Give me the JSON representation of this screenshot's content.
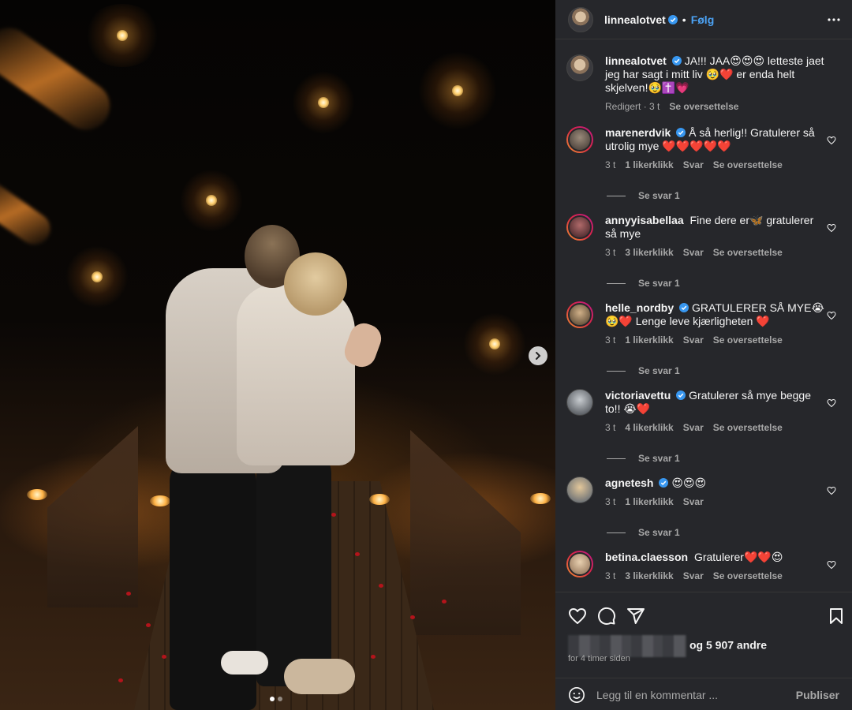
{
  "post": {
    "author": "linnealotvet",
    "follow_label": "Følg",
    "separator": "•"
  },
  "caption": {
    "username": "linnealotvet",
    "text": "JA!!! JAA😍😍😍 letteste jaet jeg har sagt i mitt liv 🥹❤️ er enda helt skjelven!🥹✝️💗",
    "edited": "Redigert · 3 t",
    "translate": "Se oversettelse"
  },
  "comments": [
    {
      "username": "marenerdvik",
      "text": "Å så herlig!! Gratulerer så utrolig mye ❤️❤️❤️❤️❤️",
      "time": "3 t",
      "likes": "1 likerklikk",
      "reply": "Svar",
      "translate": "Se oversettelse",
      "replies": "Se svar 1"
    },
    {
      "username": "annyyisabellaa",
      "text": "Fine dere er🦋 gratulerer så mye",
      "time": "3 t",
      "likes": "3 likerklikk",
      "reply": "Svar",
      "translate": "Se oversettelse",
      "replies": "Se svar 1"
    },
    {
      "username": "helle_nordby",
      "text": "GRATULERER SÅ MYE😭🥹❤️ Lenge leve kjærligheten ❤️",
      "time": "3 t",
      "likes": "1 likerklikk",
      "reply": "Svar",
      "translate": "Se oversettelse",
      "replies": "Se svar 1"
    },
    {
      "username": "victoriavettu",
      "text": "Gratulerer så mye begge to!! 😭❤️",
      "time": "3 t",
      "likes": "4 likerklikk",
      "reply": "Svar",
      "translate": "Se oversettelse",
      "replies": "Se svar 1"
    },
    {
      "username": "agnetesh",
      "text": "😍😍😍",
      "time": "3 t",
      "likes": "1 likerklikk",
      "reply": "Svar",
      "translate": "",
      "replies": "Se svar 1"
    },
    {
      "username": "betina.claesson",
      "text": "Gratulerer❤️❤️😍",
      "time": "3 t",
      "likes": "3 likerklikk",
      "reply": "Svar",
      "translate": "Se oversettelse",
      "replies": ""
    }
  ],
  "footer": {
    "likes_text": "og 5 907 andre",
    "time_ago": "for 4 timer siden",
    "comment_placeholder": "Legg til en kommentar ...",
    "publish_label": "Publiser"
  },
  "icons": {
    "verified": "verified-badge-icon",
    "more": "more-horizontal-icon",
    "like": "heart-icon",
    "comment": "comment-bubble-icon",
    "share": "paper-plane-icon",
    "save": "bookmark-icon",
    "emoji": "smiley-icon",
    "next": "chevron-right-icon"
  },
  "colors": {
    "panel_bg": "#26272b",
    "link_blue": "#4ca3f5",
    "verified_blue": "#3897f0",
    "muted_text": "#a8a8a8"
  },
  "carousel": {
    "total": 2,
    "active": 1
  }
}
